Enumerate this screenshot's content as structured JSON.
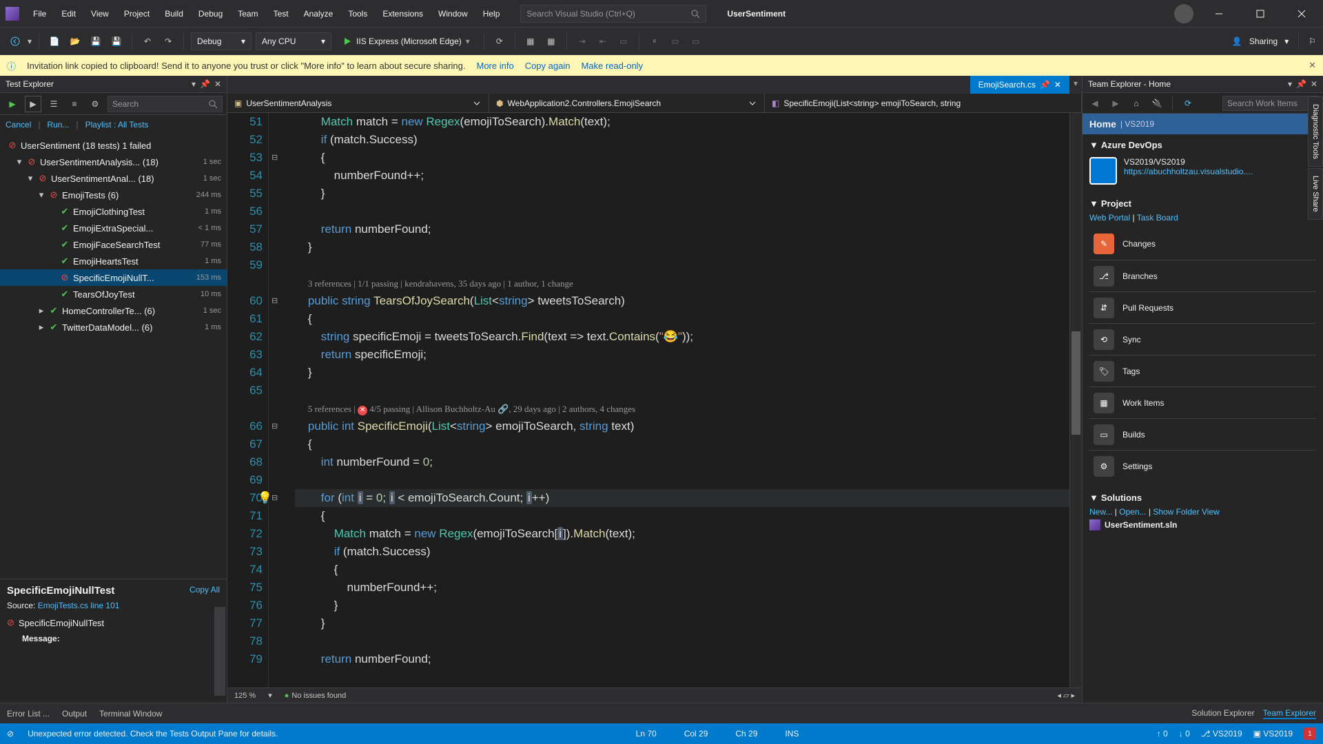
{
  "menu": [
    "File",
    "Edit",
    "View",
    "Project",
    "Build",
    "Debug",
    "Team",
    "Test",
    "Analyze",
    "Tools",
    "Extensions",
    "Window",
    "Help"
  ],
  "searchPlaceholder": "Search Visual Studio (Ctrl+Q)",
  "appTitle": "UserSentiment",
  "toolbar": {
    "config": "Debug",
    "platform": "Any CPU",
    "start": "IIS Express (Microsoft Edge)",
    "share": "Sharing"
  },
  "info": {
    "msg": "Invitation link copied to clipboard! Send it to anyone you trust or click \"More info\" to learn about secure sharing.",
    "moreInfo": "More info",
    "copyAgain": "Copy again",
    "readOnly": "Make read-only"
  },
  "testExplorer": {
    "title": "Test Explorer",
    "searchPlaceholder": "Search",
    "cancel": "Cancel",
    "run": "Run...",
    "playlist": "Playlist : All Tests",
    "root": "UserSentiment (18 tests) 1 failed",
    "groups": [
      {
        "indent": 1,
        "chev": true,
        "name": "UserSentimentAnalysis... (18)",
        "time": "1 sec",
        "status": "fail"
      },
      {
        "indent": 2,
        "chev": true,
        "name": "UserSentimentAnal... (18)",
        "time": "1 sec",
        "status": "fail"
      },
      {
        "indent": 3,
        "chev": true,
        "name": "EmojiTests (6)",
        "time": "244 ms",
        "status": "fail"
      },
      {
        "indent": 4,
        "chev": false,
        "name": "EmojiClothingTest",
        "time": "1 ms",
        "status": "pass"
      },
      {
        "indent": 4,
        "chev": false,
        "name": "EmojiExtraSpecial...",
        "time": "< 1 ms",
        "status": "pass"
      },
      {
        "indent": 4,
        "chev": false,
        "name": "EmojiFaceSearchTest",
        "time": "77 ms",
        "status": "pass"
      },
      {
        "indent": 4,
        "chev": false,
        "name": "EmojiHeartsTest",
        "time": "1 ms",
        "status": "pass"
      },
      {
        "indent": 4,
        "chev": false,
        "name": "SpecificEmojiNullT...",
        "time": "153 ms",
        "status": "fail",
        "selected": true
      },
      {
        "indent": 4,
        "chev": false,
        "name": "TearsOfJoyTest",
        "time": "10 ms",
        "status": "pass"
      },
      {
        "indent": 3,
        "chev": true,
        "collapsed": true,
        "name": "HomeControllerTe... (6)",
        "time": "1 sec",
        "status": "pass"
      },
      {
        "indent": 3,
        "chev": true,
        "collapsed": true,
        "name": "TwitterDataModel... (6)",
        "time": "1 ms",
        "status": "pass"
      }
    ],
    "detail": {
      "name": "SpecificEmojiNullTest",
      "copy": "Copy All",
      "sourceLabel": "Source:",
      "sourceLink": "EmojiTests.cs line 101",
      "failName": "SpecificEmojiNullTest",
      "message": "Message:"
    }
  },
  "editor": {
    "tab": "EmojiSearch.cs",
    "nav1": "UserSentimentAnalysis",
    "nav2": "WebApplication2.Controllers.EmojiSearch",
    "nav3": "SpecificEmoji(List<string> emojiToSearch, string",
    "firstLine": 51,
    "lens1": "3 references | 1/1 passing | kendrahavens, 35 days ago | 1 author, 1 change",
    "lens2a": "5 references | ",
    "lens2b": " 4/5 passing | Allison Buchholtz-Au ",
    "lens2c": ", 29 days ago | 2 authors, 4 changes",
    "zoom": "125 %",
    "issues": "No issues found"
  },
  "teamExplorer": {
    "title": "Team Explorer - Home",
    "searchPlaceholder": "Search Work Items",
    "home": "Home",
    "homeSub": "| VS2019",
    "azure": "Azure DevOps",
    "repo": "VS2019/VS2019",
    "url": "https://abuchholtzau.visualstudio....",
    "project": "Project",
    "webPortal": "Web Portal",
    "taskBoard": "Task Board",
    "tiles": [
      "Changes",
      "Branches",
      "Pull Requests",
      "Sync",
      "Tags",
      "Work Items",
      "Builds",
      "Settings"
    ],
    "solutions": "Solutions",
    "new": "New...",
    "open": "Open...",
    "folderView": "Show Folder View",
    "sln": "UserSentiment.sln"
  },
  "sideTabs": [
    "Diagnostic Tools",
    "Live Share"
  ],
  "bottom": {
    "tabs": [
      "Error List ...",
      "Output",
      "Terminal Window"
    ],
    "rightTabs": [
      "Solution Explorer",
      "Team Explorer"
    ]
  },
  "status": {
    "msg": "Unexpected error detected. Check the Tests Output Pane for details.",
    "ln": "Ln 70",
    "col": "Col 29",
    "ch": "Ch 29",
    "ins": "INS",
    "up": "0",
    "down": "0",
    "repo1": "VS2019",
    "repo2": "VS2019",
    "notif": "1"
  }
}
